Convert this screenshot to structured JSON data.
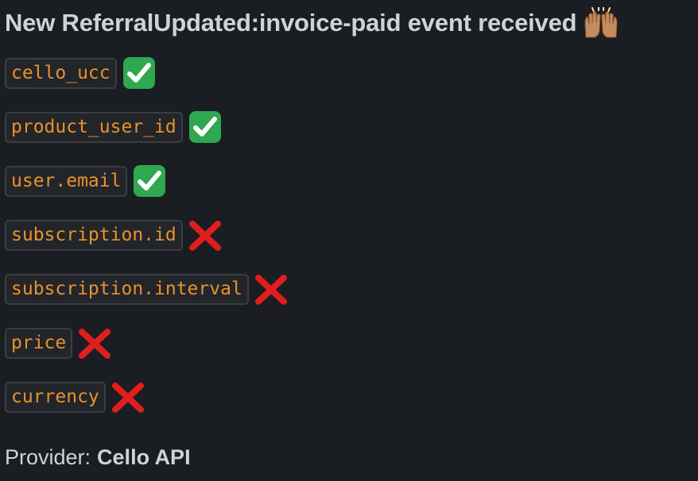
{
  "message": {
    "title": "New ReferralUpdated:invoice-paid event received",
    "title_icon": "raised-hands-icon",
    "fields": [
      {
        "name": "cello_ucc",
        "status": "present",
        "icon": "white-check-mark-icon"
      },
      {
        "name": "product_user_id",
        "status": "present",
        "icon": "white-check-mark-icon"
      },
      {
        "name": "user.email",
        "status": "present",
        "icon": "white-check-mark-icon"
      },
      {
        "name": "subscription.id",
        "status": "missing",
        "icon": "cross-mark-icon"
      },
      {
        "name": "subscription.interval",
        "status": "missing",
        "icon": "cross-mark-icon"
      },
      {
        "name": "price",
        "status": "missing",
        "icon": "cross-mark-icon"
      },
      {
        "name": "currency",
        "status": "missing",
        "icon": "cross-mark-icon"
      }
    ],
    "provider_label": "Provider:",
    "provider_value": "Cello API"
  },
  "colors": {
    "background": "#1a1d21",
    "text": "#d1d2d3",
    "code_text": "#e8912d",
    "code_background": "#222529",
    "code_border": "#3a3d42",
    "check_green": "#2fa84f",
    "cross_red": "#e01e1e"
  }
}
